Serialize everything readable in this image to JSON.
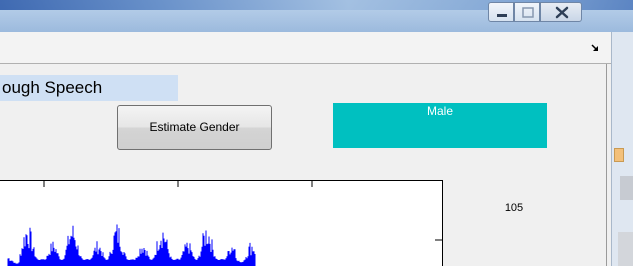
{
  "window": {
    "controls": [
      {
        "name": "minimize",
        "icon": "minimize-icon"
      },
      {
        "name": "maximize",
        "icon": "maximize-icon"
      },
      {
        "name": "close",
        "icon": "close-icon"
      }
    ],
    "dock_icon": "undock-arrow-icon"
  },
  "app": {
    "title_text": "ough Speech",
    "estimate_button_label": "Estimate Gender",
    "result_label": "Male",
    "result_color": "#00c0c0",
    "number_value": "105"
  },
  "plot": {
    "waveform_color": "#0000ff"
  }
}
